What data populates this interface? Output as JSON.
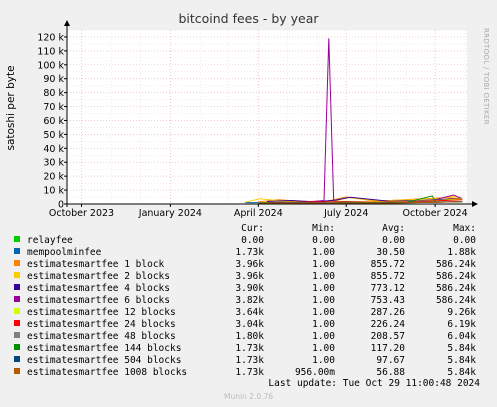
{
  "chart_data": {
    "type": "line",
    "title": "bitcoind fees - by year",
    "ylabel": "satoshi per byte",
    "side_label": "RRDTOOL / TOBI OETIKER",
    "ylim": [
      0,
      125000
    ],
    "yticks": [
      0,
      10000,
      20000,
      30000,
      40000,
      50000,
      60000,
      70000,
      80000,
      90000,
      100000,
      110000,
      120000
    ],
    "ytick_labels": [
      "0",
      "10 k",
      "20 k",
      "30 k",
      "40 k",
      "50 k",
      "60 k",
      "70 k",
      "80 k",
      "90 k",
      "100 k",
      "110 k",
      "120 k"
    ],
    "xlim": [
      "2023-09-16",
      "2024-11-03"
    ],
    "xticks": [
      "2023-10-01",
      "2024-01-01",
      "2024-04-01",
      "2024-07-01",
      "2024-10-01"
    ],
    "xtick_labels": [
      "October 2023",
      "January 2024",
      "April 2024",
      "July 2024",
      "October 2024"
    ],
    "grid": true,
    "series": [
      {
        "name": "relayfee",
        "color": "#00cc00",
        "points": [
          [
            "2024-03-18",
            0
          ],
          [
            "2024-10-29",
            0
          ]
        ]
      },
      {
        "name": "mempoolminfee",
        "color": "#0066b3",
        "points": [
          [
            "2024-03-18",
            1000
          ],
          [
            "2024-06-01",
            1000
          ],
          [
            "2024-08-20",
            1500
          ],
          [
            "2024-09-20",
            1200
          ],
          [
            "2024-10-29",
            1730
          ]
        ]
      },
      {
        "name": "estimatesmartfee 1 block",
        "color": "#ff8000",
        "points": [
          [
            "2024-04-01",
            1500
          ],
          [
            "2024-04-22",
            3000
          ],
          [
            "2024-05-15",
            2000
          ],
          [
            "2024-06-10",
            1800
          ],
          [
            "2024-07-01",
            5000
          ],
          [
            "2024-08-01",
            2000
          ],
          [
            "2024-09-10",
            3500
          ],
          [
            "2024-10-10",
            4500
          ],
          [
            "2024-10-29",
            3960
          ]
        ]
      },
      {
        "name": "estimatesmartfee 2 blocks",
        "color": "#ffcc00",
        "points": [
          [
            "2024-03-18",
            1200
          ],
          [
            "2024-04-03",
            3800
          ],
          [
            "2024-04-20",
            2500
          ],
          [
            "2024-05-20",
            1600
          ],
          [
            "2024-06-15",
            1500
          ],
          [
            "2024-07-03",
            4500
          ],
          [
            "2024-08-05",
            2200
          ],
          [
            "2024-09-05",
            3000
          ],
          [
            "2024-10-05",
            4000
          ],
          [
            "2024-10-22",
            5500
          ],
          [
            "2024-10-29",
            3960
          ]
        ]
      },
      {
        "name": "estimatesmartfee 4 blocks",
        "color": "#330099",
        "points": [
          [
            "2024-04-10",
            1800
          ],
          [
            "2024-05-05",
            2500
          ],
          [
            "2024-05-30",
            1500
          ],
          [
            "2024-06-20",
            2800
          ],
          [
            "2024-07-05",
            4800
          ],
          [
            "2024-08-15",
            2000
          ],
          [
            "2024-09-15",
            2500
          ],
          [
            "2024-10-15",
            3500
          ],
          [
            "2024-10-29",
            3900
          ]
        ]
      },
      {
        "name": "estimatesmartfee 6 blocks",
        "color": "#990099",
        "points": [
          [
            "2024-04-15",
            1000
          ],
          [
            "2024-05-18",
            1200
          ],
          [
            "2024-06-08",
            2500
          ],
          [
            "2024-06-13",
            119000
          ],
          [
            "2024-06-18",
            2000
          ],
          [
            "2024-07-10",
            1500
          ],
          [
            "2024-08-10",
            1200
          ],
          [
            "2024-09-25",
            2000
          ],
          [
            "2024-10-20",
            6500
          ],
          [
            "2024-10-29",
            3820
          ]
        ]
      },
      {
        "name": "estimatesmartfee 12 blocks",
        "color": "#ccff00",
        "points": [
          [
            "2024-04-01",
            800
          ],
          [
            "2024-05-01",
            1500
          ],
          [
            "2024-06-01",
            1200
          ],
          [
            "2024-07-01",
            2000
          ],
          [
            "2024-08-01",
            1500
          ],
          [
            "2024-09-01",
            1800
          ],
          [
            "2024-10-01",
            2500
          ],
          [
            "2024-10-29",
            3640
          ]
        ]
      },
      {
        "name": "estimatesmartfee 24 blocks",
        "color": "#ff0000",
        "points": [
          [
            "2024-04-01",
            700
          ],
          [
            "2024-05-01",
            1200
          ],
          [
            "2024-06-12",
            1500
          ],
          [
            "2024-07-01",
            1800
          ],
          [
            "2024-08-01",
            1300
          ],
          [
            "2024-09-01",
            1600
          ],
          [
            "2024-10-01",
            2200
          ],
          [
            "2024-10-29",
            3040
          ]
        ]
      },
      {
        "name": "estimatesmartfee 48 blocks",
        "color": "#808080",
        "points": [
          [
            "2024-04-01",
            600
          ],
          [
            "2024-05-01",
            1000
          ],
          [
            "2024-06-01",
            900
          ],
          [
            "2024-07-01",
            1400
          ],
          [
            "2024-08-01",
            1100
          ],
          [
            "2024-09-01",
            1300
          ],
          [
            "2024-10-01",
            1600
          ],
          [
            "2024-10-29",
            1800
          ]
        ]
      },
      {
        "name": "estimatesmartfee 144 blocks",
        "color": "#008f00",
        "points": [
          [
            "2024-04-01",
            500
          ],
          [
            "2024-05-01",
            800
          ],
          [
            "2024-06-01",
            700
          ],
          [
            "2024-07-01",
            1000
          ],
          [
            "2024-08-01",
            900
          ],
          [
            "2024-09-01",
            1100
          ],
          [
            "2024-09-28",
            5800
          ],
          [
            "2024-10-02",
            1200
          ],
          [
            "2024-10-29",
            1730
          ]
        ]
      },
      {
        "name": "estimatesmartfee 504 blocks",
        "color": "#00487d",
        "points": [
          [
            "2024-04-01",
            400
          ],
          [
            "2024-05-01",
            700
          ],
          [
            "2024-06-01",
            600
          ],
          [
            "2024-07-01",
            900
          ],
          [
            "2024-08-01",
            800
          ],
          [
            "2024-09-01",
            1000
          ],
          [
            "2024-10-01",
            1300
          ],
          [
            "2024-10-29",
            1730
          ]
        ]
      },
      {
        "name": "estimatesmartfee 1008 blocks",
        "color": "#b35a00",
        "points": [
          [
            "2024-04-01",
            300
          ],
          [
            "2024-05-01",
            600
          ],
          [
            "2024-06-01",
            500
          ],
          [
            "2024-07-01",
            800
          ],
          [
            "2024-08-01",
            700
          ],
          [
            "2024-09-01",
            900
          ],
          [
            "2024-10-01",
            1200
          ],
          [
            "2024-10-29",
            1730
          ]
        ]
      }
    ]
  },
  "legend": {
    "headers": {
      "cur": "Cur:",
      "min": "Min:",
      "avg": "Avg:",
      "max": "Max:"
    },
    "rows": [
      {
        "name": "relayfee",
        "color": "#00cc00",
        "cur": "0.00",
        "min": "0.00",
        "avg": "0.00",
        "max": "0.00"
      },
      {
        "name": "mempoolminfee",
        "color": "#0066b3",
        "cur": "1.73k",
        "min": "1.00",
        "avg": "30.50",
        "max": "1.88k"
      },
      {
        "name": "estimatesmartfee 1 block",
        "color": "#ff8000",
        "cur": "3.96k",
        "min": "1.00",
        "avg": "855.72",
        "max": "586.24k"
      },
      {
        "name": "estimatesmartfee 2 blocks",
        "color": "#ffcc00",
        "cur": "3.96k",
        "min": "1.00",
        "avg": "855.72",
        "max": "586.24k"
      },
      {
        "name": "estimatesmartfee 4 blocks",
        "color": "#330099",
        "cur": "3.90k",
        "min": "1.00",
        "avg": "773.12",
        "max": "586.24k"
      },
      {
        "name": "estimatesmartfee 6 blocks",
        "color": "#990099",
        "cur": "3.82k",
        "min": "1.00",
        "avg": "753.43",
        "max": "586.24k"
      },
      {
        "name": "estimatesmartfee 12 blocks",
        "color": "#ccff00",
        "cur": "3.64k",
        "min": "1.00",
        "avg": "287.26",
        "max": "9.26k"
      },
      {
        "name": "estimatesmartfee 24 blocks",
        "color": "#ff0000",
        "cur": "3.04k",
        "min": "1.00",
        "avg": "226.24",
        "max": "6.19k"
      },
      {
        "name": "estimatesmartfee 48 blocks",
        "color": "#808080",
        "cur": "1.80k",
        "min": "1.00",
        "avg": "208.57",
        "max": "6.04k"
      },
      {
        "name": "estimatesmartfee 144 blocks",
        "color": "#008f00",
        "cur": "1.73k",
        "min": "1.00",
        "avg": "117.20",
        "max": "5.84k"
      },
      {
        "name": "estimatesmartfee 504 blocks",
        "color": "#00487d",
        "cur": "1.73k",
        "min": "1.00",
        "avg": "97.67",
        "max": "5.84k"
      },
      {
        "name": "estimatesmartfee 1008 blocks",
        "color": "#b35a00",
        "cur": "1.73k",
        "min": "956.00m",
        "avg": "56.88",
        "max": "5.84k"
      }
    ]
  },
  "last_update": "Last update: Tue Oct 29 11:00:48 2024",
  "footer": "Munin 2.0.76"
}
